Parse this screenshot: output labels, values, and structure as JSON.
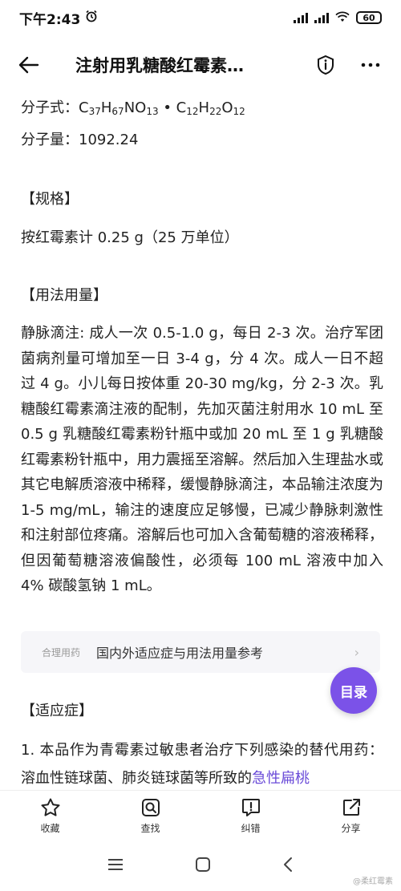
{
  "status_bar": {
    "time": "下午2:43",
    "battery": "60"
  },
  "header": {
    "title": "注射用乳糖酸红霉素…"
  },
  "drug": {
    "formula_label": "分子式：",
    "formula_parts": {
      "c1": "C",
      "c1n": "37",
      "h1": "H",
      "h1n": "67",
      "no": "NO",
      "non": "13",
      "dot": " • ",
      "c2": "C",
      "c2n": "12",
      "h2": "H",
      "h2n": "22",
      "o": "O",
      "on": "12"
    },
    "mw": "分子量：1092.24"
  },
  "spec": {
    "heading": "【规格】",
    "text": "按红霉素计 0.25 g（25 万单位）"
  },
  "usage": {
    "heading": "【用法用量】",
    "text": "静脉滴注: 成人一次 0.5-1.0 g，每日 2-3 次。治疗军团菌病剂量可增加至一日 3-4 g，分 4 次。成人一日不超过 4 g。小儿每日按体重 20-30 mg/kg，分 2-3 次。乳糖酸红霉素滴注液的配制，先加灭菌注射用水 10 mL 至 0.5 g 乳糖酸红霉素粉针瓶中或加 20 mL 至 1 g 乳糖酸红霉素粉针瓶中，用力震摇至溶解。然后加入生理盐水或其它电解质溶液中稀释，缓慢静脉滴注，本品输注浓度为 1-5 mg/mL，输注的速度应足够慢，已减少静脉刺激性和注射部位疼痛。溶解后也可加入含葡萄糖的溶液稀释，但因葡萄糖溶液偏酸性，必须每 100 mL 溶液中加入 4% 碳酸氢钠 1 mL。"
  },
  "reference": {
    "tag": "合理用药",
    "text": "国内外适应症与用法用量参考",
    "arrow": "›"
  },
  "toc_button": "目录",
  "indications": {
    "heading": "【适应症】",
    "text_before_link": "1. 本品作为青霉素过敏患者治疗下列感染的替代用药：溶血性链球菌、肺炎链球菌等所致的",
    "link": "急性扁桃"
  },
  "toolbar": [
    {
      "label": "收藏",
      "icon": "star-icon"
    },
    {
      "label": "查找",
      "icon": "search-icon"
    },
    {
      "label": "纠错",
      "icon": "error-report-icon"
    },
    {
      "label": "分享",
      "icon": "share-icon"
    }
  ],
  "watermark": "@柔红霉素"
}
